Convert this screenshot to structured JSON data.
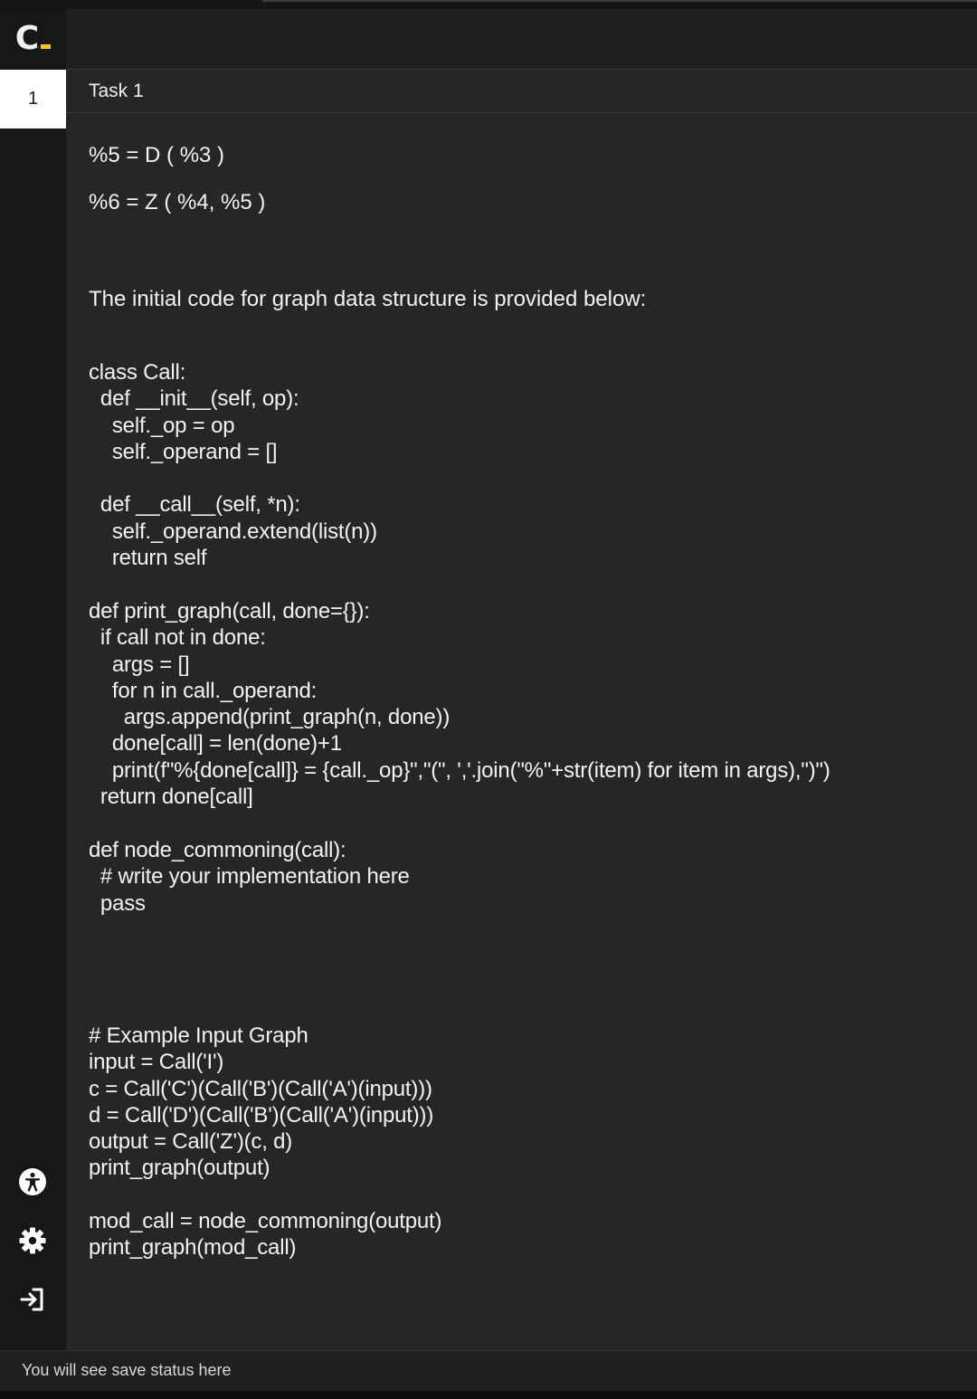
{
  "app": {
    "logo_letter": "C"
  },
  "sidebar": {
    "task_number": "1",
    "icons": [
      "accessibility-icon",
      "gear-icon",
      "logout-icon"
    ]
  },
  "task": {
    "title": "Task 1"
  },
  "content": {
    "eq1": "%5 = D ( %3 )",
    "eq2": "%6 = Z ( %4, %5 )",
    "intro": "The initial code for graph data structure is provided below:",
    "code_class": "class Call:\n  def __init__(self, op):\n    self._op = op\n    self._operand = []\n\n  def __call__(self, *n):\n    self._operand.extend(list(n))\n    return self",
    "code_print": "def print_graph(call, done={}):\n  if call not in done:\n    args = []\n    for n in call._operand:\n      args.append(print_graph(n, done))\n    done[call] = len(done)+1\n    print(f\"%{done[call]} = {call._op}\",\"(\", ','.join(\"%\"+str(item) for item in args),\")\")\n  return done[call]",
    "code_commoning": "def node_commoning(call):\n  # write your implementation here\n  pass",
    "code_example": "# Example Input Graph\ninput = Call('I')\nc = Call('C')(Call('B')(Call('A')(input)))\nd = Call('D')(Call('B')(Call('A')(input)))\noutput = Call('Z')(c, d)\nprint_graph(output)",
    "code_mod": "mod_call = node_commoning(output)\nprint_graph(mod_call)"
  },
  "status": {
    "text": "You will see save status here"
  },
  "colors": {
    "accent": "#f5c518",
    "background": "#262625",
    "sidebar": "#161717"
  }
}
